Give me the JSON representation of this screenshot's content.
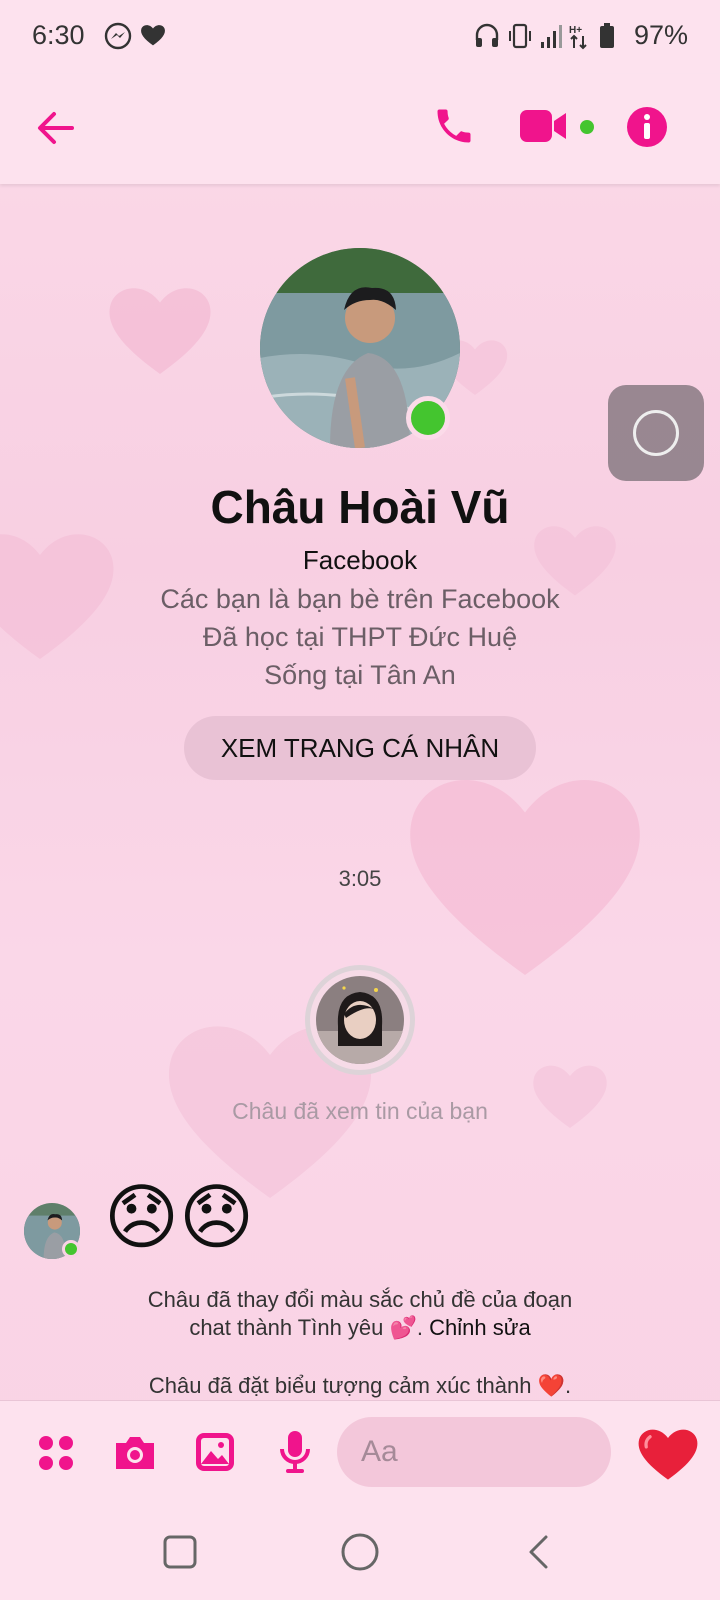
{
  "colors": {
    "accent": "#f0148c",
    "online": "#44c52f",
    "heart": "#e8203a"
  },
  "status_bar": {
    "time": "6:30",
    "battery": "97%",
    "icons": [
      "messenger-icon",
      "heart-icon",
      "headphones-icon",
      "vibrate-icon",
      "signal-icon",
      "data-arrows-icon",
      "battery-icon"
    ]
  },
  "header": {
    "icons": [
      "back-arrow-icon",
      "phone-icon",
      "video-camera-icon",
      "info-icon"
    ]
  },
  "profile": {
    "name": "Châu Hoài Vũ",
    "source": "Facebook",
    "lines": [
      "Các bạn là bạn bè trên Facebook",
      "Đã học tại THPT Đức Huệ",
      "Sống tại Tân An"
    ],
    "view_profile_label": "XEM TRANG CÁ NHÂN"
  },
  "conversation": {
    "timestamp": "3:05",
    "story_caption": "Châu đã xem tin của bạn",
    "emoji_message": "😞😞",
    "system_messages": {
      "theme_prefix": "Châu đã thay đổi màu sắc chủ đề của đoạn",
      "theme_suffix": "chat thành Tình yêu 💕.",
      "edit_label": "Chỉnh sửa",
      "emoji_set": "Châu đã đặt biểu tượng cảm xúc thành ❤️."
    }
  },
  "composer": {
    "placeholder": "Aa",
    "icons": [
      "apps-grid-icon",
      "camera-icon",
      "gallery-icon",
      "microphone-icon",
      "emoji-icon",
      "heart-send-icon"
    ]
  },
  "nav_bar": {
    "icons": [
      "recents-icon",
      "home-icon",
      "back-icon"
    ]
  }
}
